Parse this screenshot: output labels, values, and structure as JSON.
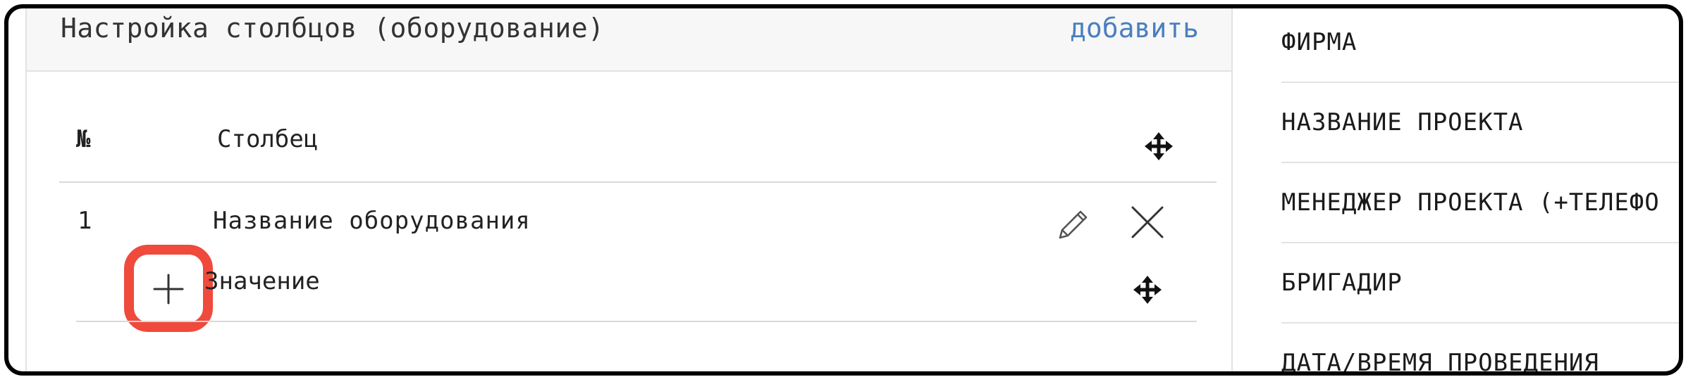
{
  "panel": {
    "title": "Настройка столбцов (оборудование)",
    "add_label": "добавить"
  },
  "table": {
    "headers": {
      "number": "№",
      "column": "Столбец"
    },
    "rows": [
      {
        "number": "1",
        "name": "Название оборудования",
        "sub_label": "Значение"
      }
    ]
  },
  "side_list": {
    "items": [
      "ФИРМА",
      "НАЗВАНИЕ ПРОЕКТА",
      "МЕНЕДЖЕР ПРОЕКТА (+ТЕЛЕФО",
      "БРИГАДИР",
      "ДАТА/ВРЕМЯ ПРОВЕДЕНИЯ"
    ]
  },
  "colors": {
    "link": "#4a7fbf",
    "highlight": "#ef4a3c",
    "header_bg": "#f7f7f7",
    "divider": "#d9d9d9"
  },
  "icons": [
    "move-icon",
    "pencil-icon",
    "close-icon",
    "plus-icon"
  ]
}
